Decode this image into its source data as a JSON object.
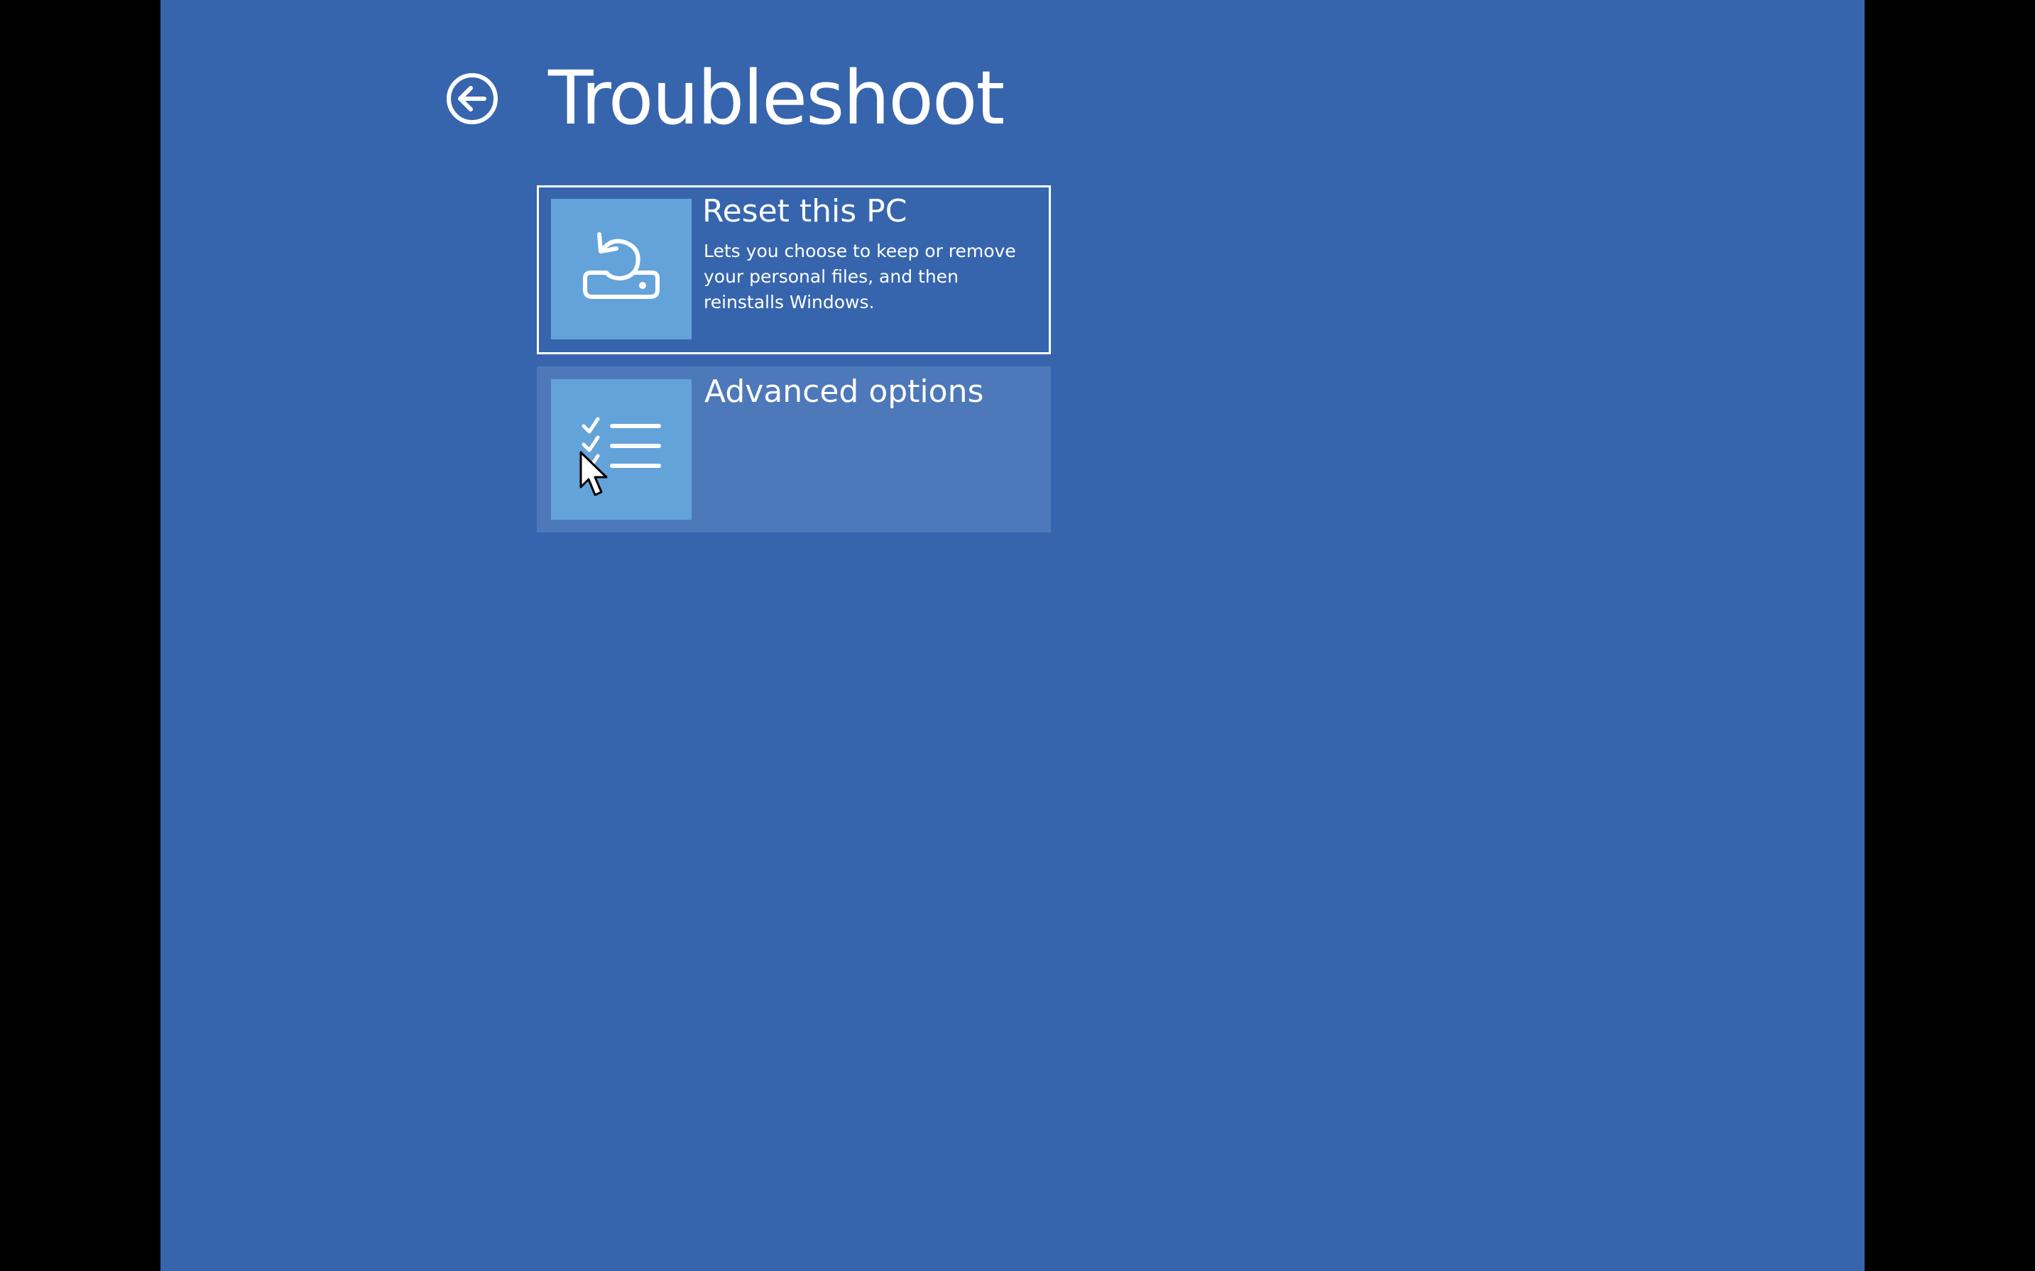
{
  "page": {
    "title": "Troubleshoot",
    "background_color": "#3665ae",
    "letterbox_color": "#000000"
  },
  "back_button": {
    "icon": "back-arrow-circle-icon"
  },
  "options": [
    {
      "title": "Reset this PC",
      "description": "Lets you choose to keep or remove your personal files, and then reinstalls Windows.",
      "icon": "reset-drive-icon",
      "state": "focused"
    },
    {
      "title": "Advanced options",
      "description": "",
      "icon": "checklist-icon",
      "state": "hover"
    }
  ],
  "colors": {
    "tile_icon_bg": "#63a3da",
    "tile_hover_bg": "#4d78b9",
    "text": "#ffffff"
  }
}
